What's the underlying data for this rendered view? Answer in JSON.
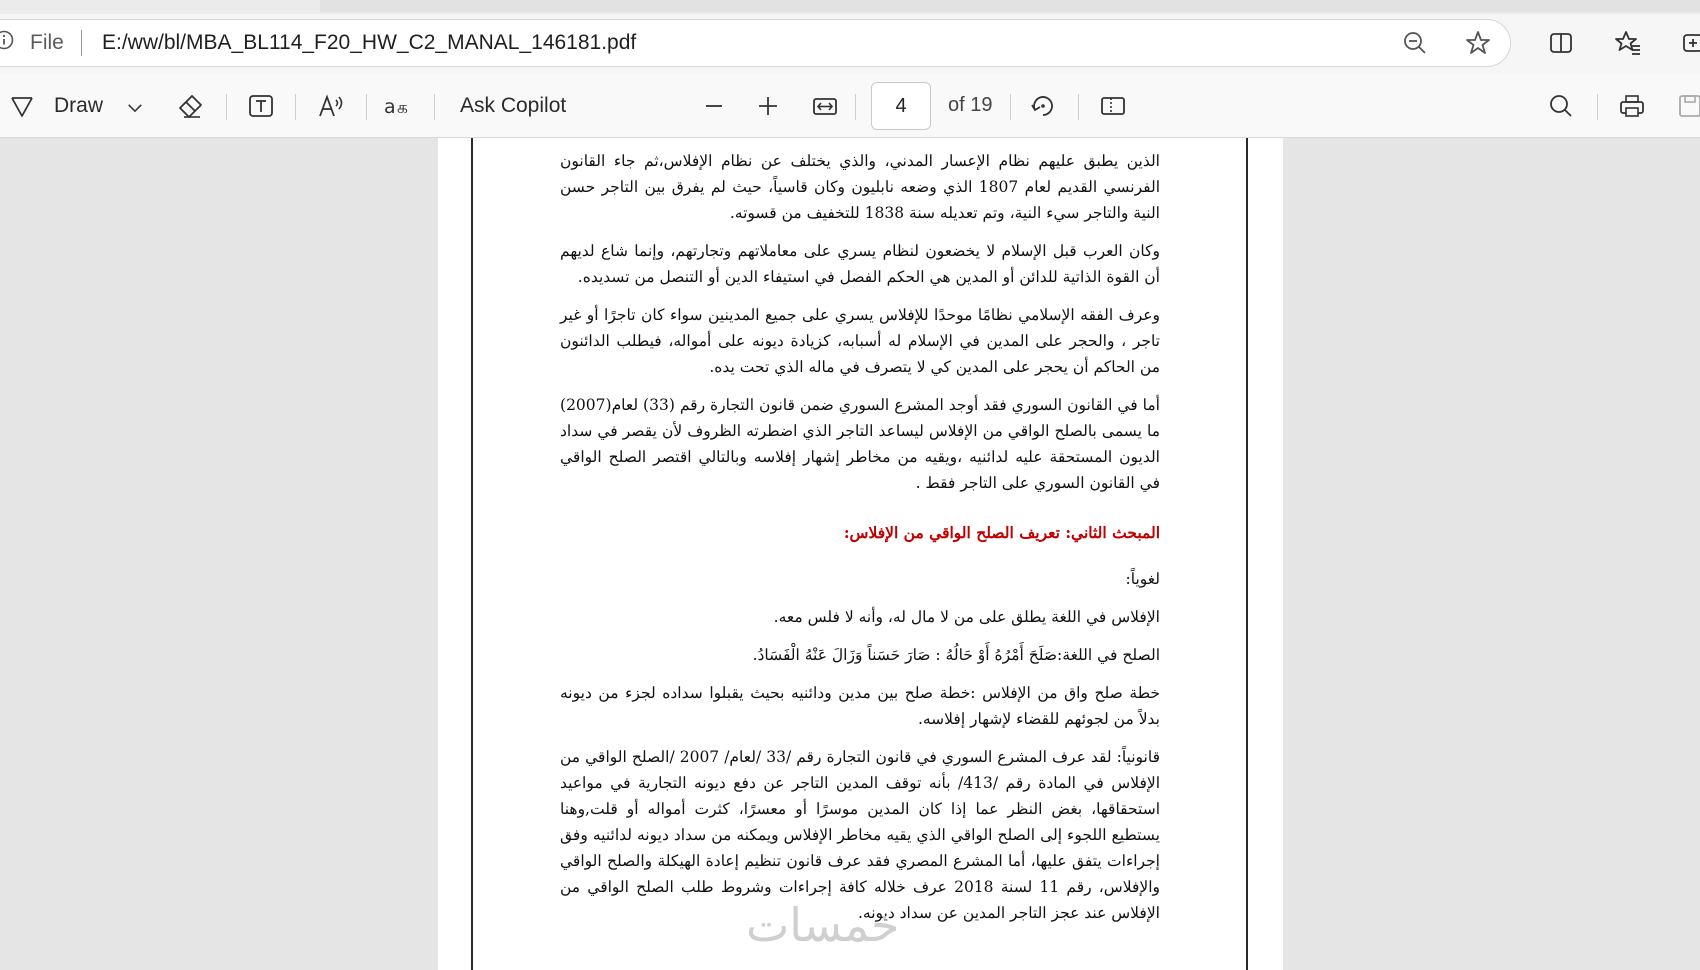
{
  "browser": {
    "file_label": "File",
    "url": "E:/ww/bl/MBA_BL114_F20_HW_C2_MANAL_146181.pdf"
  },
  "pdf_toolbar": {
    "draw_label": "Draw",
    "ask_copilot_label": "Ask Copilot",
    "page_current": "4",
    "page_total_label": "of 19"
  },
  "document": {
    "p1": "الذين يطبق عليهم نظام الإعسار المدني، والذي يختلف عن نظام الإفلاس،ثم جاء القانون الفرنسي القديم لعام 1807 الذي وضعه نابليون وكان قاسياً، حيث لم يفرق بين التاجر حسن النية والتاجر سيء النية، وتم تعديله سنة 1838 للتخفيف من قسوته.",
    "p2": "وكان العرب قبل الإسلام لا يخضعون لنظام يسري على معاملاتهم وتجارتهم، وإنما شاع لديهم أن القوة الذاتية للدائن أو المدين هي الحكم الفصل في استيفاء الدين أو التنصل من تسديده.",
    "p3": "وعرف الفقه الإسلامي نظامًا موحدًا للإفلاس يسري على جميع المدينين سواء كان تاجرًا أو غير تاجر ، والحجر على المدين في الإسلام له أسبابه، كزيادة ديونه على أمواله، فيطلب الدائنون من الحاكم أن يحجر على المدين كي لا يتصرف في ماله الذي تحت يده.",
    "p4": "أما في القانون السوري فقد أوجد المشرع السوري ضمن قانون التجارة رقم (33) لعام(2007) ما يسمى بالصلح الواقي من الإفلاس ليساعد التاجر الذي اضطرته الظروف لأن يقصر في سداد الديون المستحقة عليه لدائنيه ،ويقيه من مخاطر إشهار إفلاسه وبالتالي اقتصر الصلح الواقي في القانون السوري على التاجر فقط .",
    "heading": "المبحث الثاني: تعريف الصلح الواقي من الإفلاس:",
    "p5": "لغوياً:",
    "p6": "الإفلاس في اللغة يطلق على من لا مال له، وأنه لا فلس معه.",
    "p7": "الصلح في اللغة:صَلَحَ أَمْرُهُ أَوْ حَالُهُ : صَارَ حَسَناً وَزَالَ عَنْهُ الْفَسَادُ.",
    "p8": "خطة صلح واق من الإفلاس :خطة صلح بين مدين ودائنيه بحيث يقبلوا سداده لجزء من ديونه بدلاً من لجوئهم للقضاء لإشهار إفلاسه.",
    "p9": "قانونياً: لقد عرف المشرع السوري في قانون التجارة رقم /33 /لعام/ 2007 /الصلح الواقي من الإفلاس في المادة رقم /413/ بأنه توقف المدين التاجر عن دفع ديونه التجارية في مواعيد استحقاقها، بغض النظر عما إذا كان المدين موسرًا أو معسرًا، كثرت أمواله أو قلت,وهنا يستطيع اللجوء إلى الصلح الواقي الذي يقيه مخاطر الإفلاس ويمكنه من سداد ديونه لدائنيه وفق إجراءات يتفق عليها، أما المشرع المصري فقد عرف قانون تنظيم إعادة الهيكلة والصلح الواقي والإفلاس، رقم 11 لسنة 2018 عرف خلاله كافة إجراءات وشروط طلب الصلح الواقي من الإفلاس عند عجز التاجر المدين عن سداد ديونه."
  },
  "watermark": "خمسات"
}
